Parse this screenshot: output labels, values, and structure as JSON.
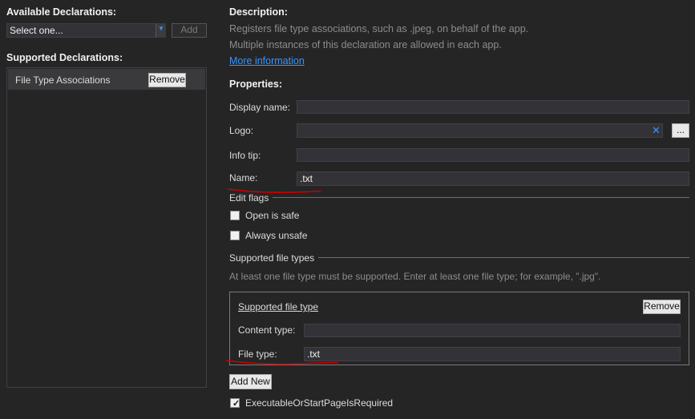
{
  "left": {
    "available_title": "Available Declarations:",
    "select_value": "Select one...",
    "add_label": "Add",
    "supported_title": "Supported Declarations:",
    "items": [
      {
        "label": "File Type Associations",
        "remove_label": "Remove"
      }
    ]
  },
  "right": {
    "description_title": "Description:",
    "desc_line1": "Registers file type associations, such as .jpeg, on behalf of the app.",
    "desc_line2": "Multiple instances of this declaration are allowed in each app.",
    "more_info": "More information",
    "properties_title": "Properties:",
    "display_name_label": "Display name:",
    "display_name_value": "",
    "logo_label": "Logo:",
    "logo_value": "",
    "browse_label": "...",
    "info_tip_label": "Info tip:",
    "info_tip_value": "",
    "name_label": "Name:",
    "name_value": ".txt",
    "edit_flags_title": "Edit flags",
    "open_is_safe": "Open is safe",
    "always_unsafe": "Always unsafe",
    "supported_file_types_title": "Supported file types",
    "supported_hint": "At least one file type must be supported. Enter at least one file type; for example, \".jpg\".",
    "file_type_box": {
      "title": "Supported file type",
      "remove_label": "Remove",
      "content_type_label": "Content type:",
      "content_type_value": "",
      "file_type_label": "File type:",
      "file_type_value": ".txt"
    },
    "add_new_label": "Add New",
    "executable_label": "ExecutableOrStartPageIsRequired"
  },
  "colors": {
    "background": "#252526",
    "field": "#333337",
    "link": "#3794ff",
    "annotation": "#cc0000"
  }
}
